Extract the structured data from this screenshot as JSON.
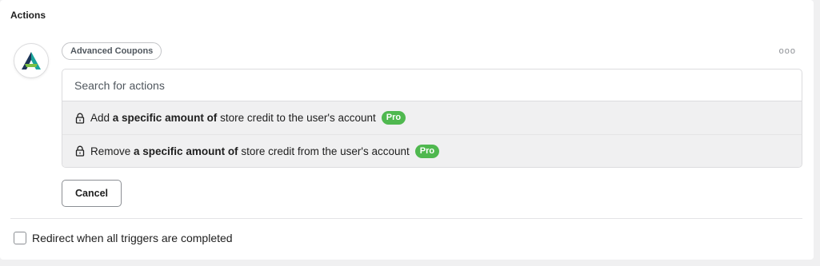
{
  "section": {
    "title": "Actions"
  },
  "integration": {
    "name": "Advanced Coupons",
    "logo_icon": "advanced-coupons-logo",
    "more_icon": "more-dots-icon",
    "more_label": "ooo"
  },
  "search": {
    "placeholder": "Search for actions",
    "value": ""
  },
  "actions": [
    {
      "prefix": "Add ",
      "bold": "a specific amount of",
      "suffix": " store credit to the user's account",
      "badge": "Pro",
      "icon": "lock-icon"
    },
    {
      "prefix": "Remove ",
      "bold": "a specific amount of",
      "suffix": " store credit from the user's account",
      "badge": "Pro",
      "icon": "lock-icon"
    }
  ],
  "buttons": {
    "cancel": "Cancel"
  },
  "redirect": {
    "label": "Redirect when all triggers are completed",
    "checked": false
  },
  "colors": {
    "pro_badge": "#4fb84f",
    "logo_teal": "#1aa39a",
    "logo_navy": "#1d3557"
  }
}
